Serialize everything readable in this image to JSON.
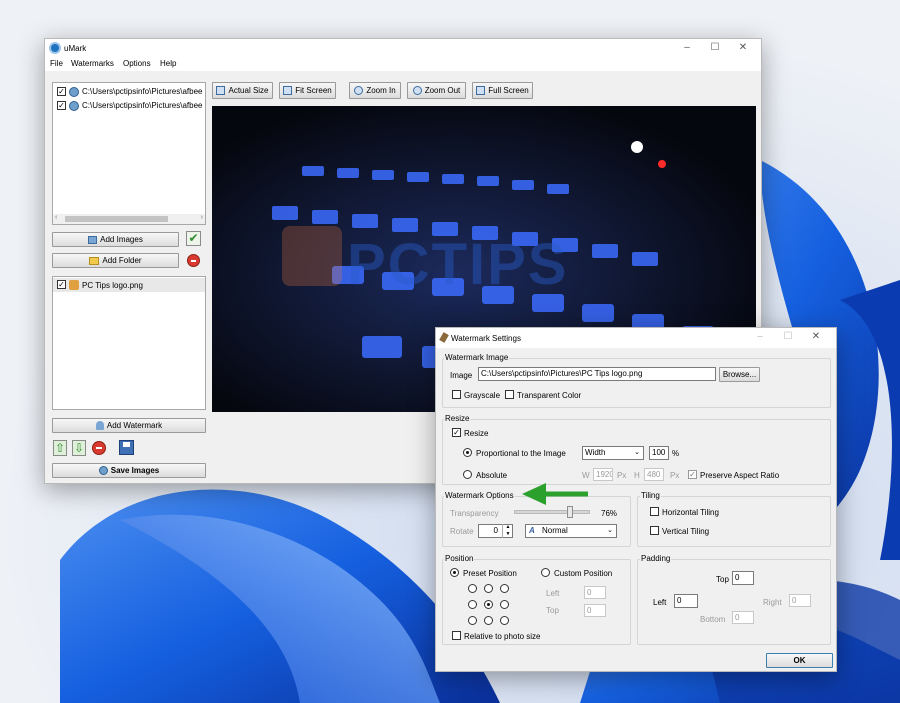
{
  "colors": {
    "accent": "#1e73be",
    "arrow": "#2ca02c",
    "close_red": "#d93a2f"
  },
  "main_window": {
    "title": "uMark",
    "menu": [
      "File",
      "Watermarks",
      "Options",
      "Help"
    ],
    "files": [
      {
        "path": "C:\\Users\\pctipsinfo\\Pictures\\afbee",
        "checked": true
      },
      {
        "path": "C:\\Users\\pctipsinfo\\Pictures\\afbee",
        "checked": true
      }
    ],
    "add_images_label": "Add Images",
    "add_folder_label": "Add Folder",
    "watermarks": [
      {
        "name": "PC Tips logo.png",
        "checked": true
      }
    ],
    "add_watermark_label": "Add Watermark",
    "save_images_label": "Save Images",
    "toolbar": {
      "actual_size": "Actual Size",
      "fit_screen": "Fit Screen",
      "zoom_in": "Zoom In",
      "zoom_out": "Zoom Out",
      "full_screen": "Full Screen"
    },
    "watermark_text": "PCTIPS"
  },
  "dialog": {
    "title": "Watermark Settings",
    "image_group": {
      "title": "Watermark Image",
      "image_label": "Image",
      "image_path": "C:\\Users\\pctipsinfo\\Pictures\\PC Tips logo.png",
      "browse_label": "Browse...",
      "grayscale_label": "Grayscale",
      "transparent_label": "Transparent Color"
    },
    "resize_group": {
      "title": "Resize",
      "resize_label": "Resize",
      "proportional_label": "Proportional to the Image",
      "dimension_select": "Width",
      "percent_value": "100",
      "percent_unit": "%",
      "absolute_label": "Absolute",
      "w_label": "W",
      "w_value": "1920",
      "w_unit": "Px",
      "h_label": "H",
      "h_value": "480",
      "h_unit": "Px",
      "aspect_label": "Preserve Aspect Ratio"
    },
    "options_group": {
      "title": "Watermark Options",
      "transparency_label": "Transparency",
      "transparency_value": "76%",
      "transparency_level": 0.76,
      "rotate_label": "Rotate",
      "rotate_value": "0",
      "font_style": "Normal"
    },
    "tiling_group": {
      "title": "Tiling",
      "horizontal_label": "Horizontal Tiling",
      "vertical_label": "Vertical Tiling"
    },
    "position_group": {
      "title": "Position",
      "preset_label": "Preset Position",
      "custom_label": "Custom Position",
      "left_label": "Left",
      "left_value": "0",
      "top_label": "Top",
      "top_value": "0",
      "relative_label": "Relative to photo size"
    },
    "padding_group": {
      "title": "Padding",
      "top_label": "Top",
      "top_value": "0",
      "left_label": "Left",
      "left_value": "0",
      "right_label": "Right",
      "right_value": "0",
      "bottom_label": "Bottom",
      "bottom_value": "0"
    },
    "ok_label": "OK"
  }
}
